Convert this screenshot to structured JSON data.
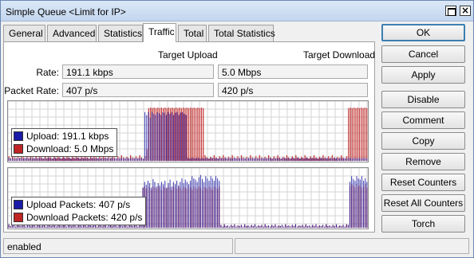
{
  "window": {
    "title": "Simple Queue <Limit for IP>"
  },
  "tabs": [
    "General",
    "Advanced",
    "Statistics",
    "Traffic",
    "Total",
    "Total Statistics"
  ],
  "active_tab": "Traffic",
  "headers": {
    "upload": "Target Upload",
    "download": "Target Download"
  },
  "rate": {
    "label": "Rate:",
    "upload": "191.1 kbps",
    "download": "5.0 Mbps"
  },
  "packet_rate": {
    "label": "Packet Rate:",
    "upload": "407 p/s",
    "download": "420 p/s"
  },
  "chart_data": [
    {
      "type": "bar",
      "title": "",
      "series": [
        {
          "name": "Upload:  191.1 kbps",
          "color": "#1a1aa6",
          "values": [
            0.05,
            0.04,
            0.05,
            0.03,
            0.05,
            0.04,
            0.05,
            0.05,
            0.04,
            0.05,
            0.05,
            0.04,
            0.05,
            0.04,
            0.05,
            0.05,
            0.04,
            0.05,
            0.05,
            0.04,
            0.05,
            0.04,
            0.05,
            0.05,
            0.04,
            0.05,
            0.05,
            0.04,
            0.05,
            0.04,
            0.05,
            0.05,
            0.04,
            0.05,
            0.05,
            0.04,
            0.05,
            0.04,
            0.05,
            0.05,
            0.04,
            0.05,
            0.05,
            0.04,
            0.05,
            0.04,
            0.05,
            0.05,
            0.04,
            0.05,
            0.05,
            0.04,
            0.05,
            0.04,
            0.05,
            0.05,
            0.04,
            0.05,
            0.05,
            0.04,
            0.05,
            0.04,
            0.05,
            0.05,
            0.04,
            0.05,
            0.05,
            0.04,
            0.05,
            0.04,
            0.05,
            0.05,
            0.04,
            0.05,
            0.05,
            0.04,
            0.85,
            0.8,
            0.85,
            0.75,
            0.85,
            0.82,
            0.8,
            0.85,
            0.83,
            0.8,
            0.85,
            0.84,
            0.8,
            0.85,
            0.82,
            0.85,
            0.8,
            0.84,
            0.85,
            0.8,
            0.84,
            0.85,
            0.82,
            0.8,
            0.05,
            0.04,
            0.05,
            0.05,
            0.04,
            0.05,
            0.05,
            0.04,
            0.05,
            0.04,
            0.05,
            0.05,
            0.04,
            0.05,
            0.05,
            0.04,
            0.05,
            0.04,
            0.05,
            0.05,
            0.04,
            0.05,
            0.05,
            0.04,
            0.05,
            0.04,
            0.05,
            0.05,
            0.04,
            0.05,
            0.05,
            0.04,
            0.05,
            0.04,
            0.05,
            0.05,
            0.04,
            0.05,
            0.05,
            0.04,
            0.05,
            0.04,
            0.05,
            0.05,
            0.04,
            0.05,
            0.05,
            0.04,
            0.05,
            0.04,
            0.05,
            0.05,
            0.04,
            0.05,
            0.05,
            0.04,
            0.05,
            0.04,
            0.05,
            0.05,
            0.04,
            0.05,
            0.05,
            0.04,
            0.05,
            0.04,
            0.05,
            0.05,
            0.04,
            0.05,
            0.05,
            0.04,
            0.05,
            0.04,
            0.05,
            0.05,
            0.04,
            0.05,
            0.05,
            0.04,
            0.05,
            0.04,
            0.05,
            0.05,
            0.04,
            0.05,
            0.05,
            0.04,
            0.05,
            0.04,
            0.05,
            0.05,
            0.04,
            0.05,
            0.05,
            0.04,
            0.05,
            0.04,
            0.05,
            0.05,
            0.04,
            0.05
          ]
        },
        {
          "name": "Download:  5.0 Mbps",
          "color": "#c02424",
          "values": [
            0.08,
            0.05,
            0.1,
            0.06,
            0.04,
            0.07,
            0.05,
            0.1,
            0.06,
            0.04,
            0.08,
            0.05,
            0.1,
            0.06,
            0.04,
            0.07,
            0.05,
            0.1,
            0.06,
            0.04,
            0.08,
            0.05,
            0.1,
            0.06,
            0.04,
            0.07,
            0.05,
            0.1,
            0.06,
            0.04,
            0.08,
            0.05,
            0.1,
            0.06,
            0.04,
            0.07,
            0.05,
            0.1,
            0.06,
            0.04,
            0.08,
            0.05,
            0.1,
            0.06,
            0.04,
            0.07,
            0.05,
            0.1,
            0.06,
            0.04,
            0.08,
            0.05,
            0.1,
            0.06,
            0.04,
            0.07,
            0.05,
            0.1,
            0.06,
            0.04,
            0.08,
            0.05,
            0.1,
            0.06,
            0.04,
            0.07,
            0.05,
            0.1,
            0.06,
            0.04,
            0.08,
            0.05,
            0.1,
            0.06,
            0.04,
            0.08,
            0.2,
            0.92,
            0.93,
            0.92,
            0.93,
            0.92,
            0.93,
            0.92,
            0.93,
            0.92,
            0.93,
            0.92,
            0.93,
            0.92,
            0.93,
            0.92,
            0.93,
            0.92,
            0.93,
            0.92,
            0.93,
            0.92,
            0.93,
            0.92,
            0.93,
            0.92,
            0.93,
            0.92,
            0.93,
            0.92,
            0.93,
            0.92,
            0.1,
            0.06,
            0.04,
            0.07,
            0.05,
            0.1,
            0.06,
            0.04,
            0.08,
            0.05,
            0.1,
            0.06,
            0.04,
            0.07,
            0.05,
            0.1,
            0.06,
            0.04,
            0.08,
            0.05,
            0.1,
            0.06,
            0.04,
            0.07,
            0.05,
            0.1,
            0.06,
            0.04,
            0.08,
            0.05,
            0.1,
            0.06,
            0.04,
            0.07,
            0.05,
            0.1,
            0.06,
            0.04,
            0.08,
            0.05,
            0.1,
            0.06,
            0.04,
            0.07,
            0.05,
            0.1,
            0.06,
            0.04,
            0.08,
            0.05,
            0.1,
            0.06,
            0.04,
            0.07,
            0.05,
            0.1,
            0.06,
            0.04,
            0.08,
            0.05,
            0.1,
            0.06,
            0.04,
            0.07,
            0.05,
            0.1,
            0.06,
            0.04,
            0.08,
            0.05,
            0.1,
            0.06,
            0.04,
            0.07,
            0.05,
            0.1,
            0.06,
            0.04,
            0.08,
            0.92,
            0.93,
            0.92,
            0.93,
            0.92,
            0.93,
            0.92,
            0.93,
            0.92,
            0.93,
            0.92,
            0.93
          ]
        }
      ]
    },
    {
      "type": "bar",
      "title": "",
      "series": [
        {
          "name": "Upload Packets:  407 p/s",
          "color": "#1a1aa6",
          "values": [
            0.06,
            0.03,
            0.08,
            0.04,
            0.02,
            0.05,
            0.07,
            0.03,
            0.06,
            0.04,
            0.02,
            0.05,
            0.07,
            0.03,
            0.06,
            0.04,
            0.02,
            0.05,
            0.07,
            0.03,
            0.06,
            0.04,
            0.02,
            0.05,
            0.07,
            0.03,
            0.06,
            0.04,
            0.02,
            0.05,
            0.07,
            0.03,
            0.06,
            0.04,
            0.02,
            0.05,
            0.07,
            0.03,
            0.06,
            0.04,
            0.02,
            0.05,
            0.07,
            0.03,
            0.06,
            0.04,
            0.02,
            0.05,
            0.07,
            0.03,
            0.06,
            0.04,
            0.02,
            0.05,
            0.07,
            0.03,
            0.06,
            0.04,
            0.02,
            0.05,
            0.07,
            0.03,
            0.06,
            0.04,
            0.02,
            0.05,
            0.07,
            0.03,
            0.06,
            0.04,
            0.02,
            0.05,
            0.07,
            0.03,
            0.06,
            0.04,
            0.02,
            0.05,
            0.2,
            0.7,
            0.8,
            0.75,
            0.82,
            0.78,
            0.7,
            0.85,
            0.8,
            0.72,
            0.78,
            0.74,
            0.8,
            0.76,
            0.82,
            0.7,
            0.78,
            0.84,
            0.72,
            0.8,
            0.76,
            0.82,
            0.74,
            0.8,
            0.86,
            0.78,
            0.84,
            0.8,
            0.76,
            0.82,
            0.9,
            0.86,
            0.84,
            0.8,
            0.88,
            0.92,
            0.85,
            0.8,
            0.9,
            0.86,
            0.82,
            0.9,
            0.86,
            0.82,
            0.9,
            0.86,
            0.82,
            0.05,
            0.02,
            0.06,
            0.03,
            0.04,
            0.02,
            0.05,
            0.03,
            0.06,
            0.02,
            0.04,
            0.03,
            0.05,
            0.02,
            0.06,
            0.03,
            0.04,
            0.02,
            0.05,
            0.03,
            0.06,
            0.02,
            0.04,
            0.03,
            0.05,
            0.02,
            0.06,
            0.03,
            0.04,
            0.02,
            0.05,
            0.03,
            0.06,
            0.02,
            0.04,
            0.03,
            0.05,
            0.02,
            0.06,
            0.03,
            0.04,
            0.02,
            0.05,
            0.03,
            0.06,
            0.02,
            0.04,
            0.03,
            0.05,
            0.02,
            0.06,
            0.03,
            0.04,
            0.02,
            0.05,
            0.03,
            0.06,
            0.02,
            0.04,
            0.03,
            0.05,
            0.02,
            0.06,
            0.03,
            0.04,
            0.02,
            0.05,
            0.03,
            0.06,
            0.02,
            0.04,
            0.03,
            0.05,
            0.02,
            0.06,
            0.05,
            0.8,
            0.9,
            0.85,
            0.82,
            0.9,
            0.86,
            0.84,
            0.9,
            0.82,
            0.86,
            0.8,
            0.88
          ]
        },
        {
          "name": "Download Packets:  420 p/s",
          "color": "#c02424",
          "values": [
            0.06,
            0.03,
            0.08,
            0.04,
            0.02,
            0.05,
            0.07,
            0.03,
            0.06,
            0.04,
            0.02,
            0.05,
            0.07,
            0.03,
            0.06,
            0.04,
            0.02,
            0.05,
            0.07,
            0.03,
            0.06,
            0.04,
            0.02,
            0.05,
            0.07,
            0.03,
            0.06,
            0.04,
            0.02,
            0.05,
            0.07,
            0.03,
            0.06,
            0.04,
            0.02,
            0.05,
            0.07,
            0.03,
            0.06,
            0.04,
            0.02,
            0.05,
            0.07,
            0.03,
            0.06,
            0.04,
            0.02,
            0.05,
            0.07,
            0.03,
            0.06,
            0.04,
            0.02,
            0.05,
            0.07,
            0.03,
            0.06,
            0.04,
            0.02,
            0.05,
            0.07,
            0.03,
            0.06,
            0.04,
            0.02,
            0.05,
            0.07,
            0.03,
            0.06,
            0.04,
            0.02,
            0.05,
            0.07,
            0.03,
            0.06,
            0.04,
            0.02,
            0.05,
            0.22,
            0.7,
            0.72,
            0.68,
            0.72,
            0.7,
            0.66,
            0.72,
            0.7,
            0.68,
            0.72,
            0.7,
            0.66,
            0.72,
            0.7,
            0.68,
            0.72,
            0.7,
            0.66,
            0.72,
            0.7,
            0.68,
            0.72,
            0.7,
            0.66,
            0.72,
            0.7,
            0.68,
            0.72,
            0.7,
            0.66,
            0.72,
            0.7,
            0.68,
            0.72,
            0.7,
            0.66,
            0.72,
            0.7,
            0.68,
            0.72,
            0.7,
            0.66,
            0.72,
            0.7,
            0.68,
            0.72,
            0.05,
            0.02,
            0.06,
            0.03,
            0.04,
            0.02,
            0.05,
            0.03,
            0.06,
            0.02,
            0.04,
            0.03,
            0.05,
            0.02,
            0.06,
            0.03,
            0.04,
            0.02,
            0.05,
            0.03,
            0.06,
            0.02,
            0.04,
            0.03,
            0.05,
            0.02,
            0.06,
            0.03,
            0.04,
            0.02,
            0.05,
            0.03,
            0.06,
            0.02,
            0.04,
            0.03,
            0.05,
            0.02,
            0.06,
            0.03,
            0.04,
            0.02,
            0.05,
            0.03,
            0.06,
            0.02,
            0.04,
            0.03,
            0.05,
            0.02,
            0.06,
            0.03,
            0.04,
            0.02,
            0.05,
            0.03,
            0.06,
            0.02,
            0.04,
            0.03,
            0.05,
            0.02,
            0.06,
            0.03,
            0.04,
            0.02,
            0.05,
            0.03,
            0.06,
            0.02,
            0.04,
            0.03,
            0.05,
            0.02,
            0.06,
            0.05,
            0.72,
            0.76,
            0.74,
            0.7,
            0.76,
            0.72,
            0.74,
            0.7,
            0.72,
            0.76,
            0.7,
            0.74
          ]
        }
      ]
    }
  ],
  "buttons": [
    "OK",
    "Cancel",
    "Apply",
    "Disable",
    "Comment",
    "Copy",
    "Remove",
    "Reset Counters",
    "Reset All Counters",
    "Torch"
  ],
  "status": {
    "text": "enabled"
  }
}
